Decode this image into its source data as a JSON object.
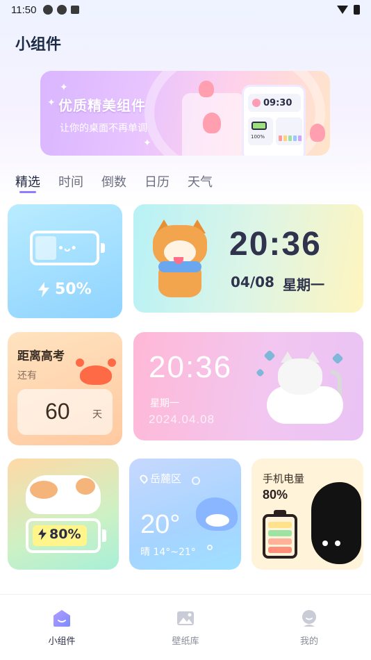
{
  "status": {
    "time": "11:50"
  },
  "page_title": "小组件",
  "banner": {
    "title": "优质精美组件",
    "subtitle": "让你的桌面不再单调",
    "preview_time": "09:30",
    "preview_pct": "100%"
  },
  "tabs": [
    "精选",
    "时间",
    "倒数",
    "日历",
    "天气"
  ],
  "widgets": {
    "battery": {
      "percent": "50%"
    },
    "clock": {
      "time": "20:36",
      "date": "04/08",
      "weekday": "星期一"
    },
    "countdown": {
      "title": "距离高考",
      "sub": "还有",
      "days": "60",
      "unit": "天"
    },
    "pink_clock": {
      "time": "20:36",
      "weekday": "星期一",
      "date": "2024.04.08"
    },
    "cat_battery": {
      "percent": "80%"
    },
    "weather": {
      "location": "岳麓区",
      "temp": "20°",
      "condition": "晴 14°~21°"
    },
    "phone_battery": {
      "title": "手机电量",
      "percent": "80%"
    }
  },
  "nav": [
    {
      "label": "小组件",
      "icon": "widget-icon",
      "active": true
    },
    {
      "label": "壁纸库",
      "icon": "wallpaper-icon",
      "active": false
    },
    {
      "label": "我的",
      "icon": "profile-icon",
      "active": false
    }
  ],
  "colors": {
    "accent": "#8d7cff",
    "text": "#2a2d45"
  }
}
